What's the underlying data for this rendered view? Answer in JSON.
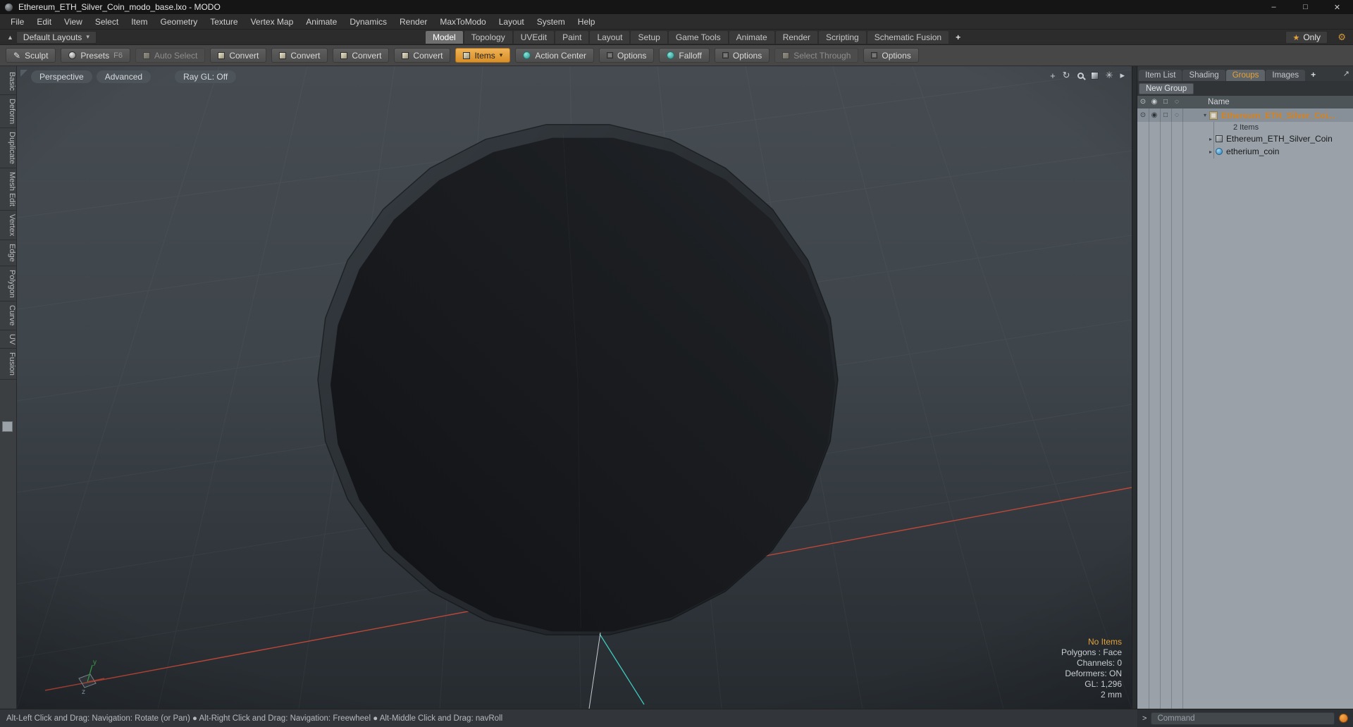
{
  "titlebar": {
    "title": "Ethereum_ETH_Silver_Coin_modo_base.lxo - MODO",
    "minimize": "–",
    "maximize": "□",
    "close": "✕"
  },
  "menu": {
    "items": [
      "File",
      "Edit",
      "View",
      "Select",
      "Item",
      "Geometry",
      "Texture",
      "Vertex Map",
      "Animate",
      "Dynamics",
      "Render",
      "MaxToModo",
      "Layout",
      "System",
      "Help"
    ]
  },
  "layout_bar": {
    "layouts_button": "Default Layouts",
    "tabs": [
      "Model",
      "Topology",
      "UVEdit",
      "Paint",
      "Layout",
      "Setup",
      "Game Tools",
      "Animate",
      "Render",
      "Scripting",
      "Schematic Fusion"
    ],
    "active_tab": "Model",
    "add_tab": "+",
    "only_star": "★",
    "only_button": "Only"
  },
  "toolbar": {
    "sculpt": "Sculpt",
    "presets": "Presets",
    "presets_key": "F6",
    "auto_select": "Auto Select",
    "convert1": "Convert",
    "convert2": "Convert",
    "convert3": "Convert",
    "convert4": "Convert",
    "items": "Items",
    "action_center": "Action Center",
    "options1": "Options",
    "falloff": "Falloff",
    "options2": "Options",
    "select_through": "Select Through",
    "options3": "Options"
  },
  "left_rail": {
    "tabs": [
      "Basic",
      "Deform",
      "Duplicate",
      "Mesh Edit",
      "Vertex",
      "Edge",
      "Polygon",
      "Curve",
      "UV",
      "Fusion"
    ]
  },
  "viewport": {
    "header": {
      "perspective": "Perspective",
      "advanced": "Advanced",
      "ray_gl": "Ray GL: Off"
    },
    "stats": {
      "no_items": "No Items",
      "polygons": "Polygons : Face",
      "channels": "Channels: 0",
      "deformers": "Deformers: ON",
      "gl": "GL: 1,296",
      "scale": "2 mm"
    },
    "gizmo_z": "z",
    "gizmo_y": "y"
  },
  "right_panel": {
    "tabs": [
      "Item List",
      "Shading",
      "Groups",
      "Images"
    ],
    "active_tab": "Groups",
    "add_tab": "+",
    "new_group_button": "New Group",
    "name_header": "Name",
    "rows": [
      {
        "label": "Ethereum_ETH_Silver_Coi...",
        "type": "group"
      },
      {
        "label": "2 Items",
        "type": "count"
      },
      {
        "label": "Ethereum_ETH_Silver_Coin",
        "type": "mesh"
      },
      {
        "label": "etherium_coin",
        "type": "mesh"
      }
    ]
  },
  "command_bar": {
    "prompt": ">",
    "placeholder": "Command"
  },
  "status_bar": {
    "text": "Alt-Left Click and Drag: Navigation: Rotate (or Pan)  ●  Alt-Right Click and Drag: Navigation: Freewheel  ●  Alt-Middle Click and Drag: navRoll"
  },
  "icons": {
    "caret_down": "▾",
    "rail_up": "▲",
    "pan": "+",
    "rotate": "↻",
    "flower": "✳",
    "arrow_right": "▸",
    "expand": "↗",
    "eye": "⊙",
    "render_dot": "◉",
    "square": "□",
    "circle_dotted": "◌",
    "expander_open": "▾",
    "expander_closed": "▸"
  },
  "colors": {
    "accent_orange": "#e09a3a",
    "group_text_orange": "#d8821c",
    "axis_red": "#cd4a38",
    "axis_teal": "#3fc9bd",
    "panel_gray": "#9aa1a8"
  }
}
